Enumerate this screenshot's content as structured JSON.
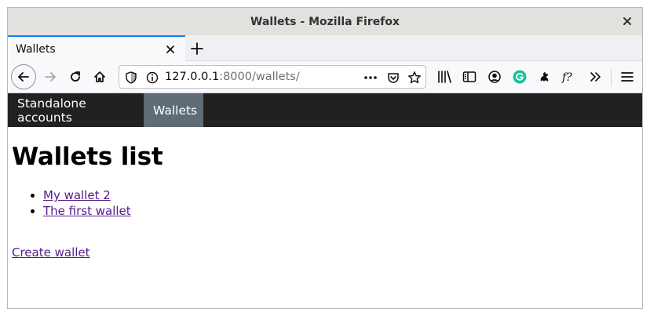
{
  "window": {
    "title": "Wallets - Mozilla Firefox"
  },
  "tabs": [
    {
      "label": "Wallets",
      "active": true
    }
  ],
  "toolbar": {
    "url_host": "127.0.0.1",
    "url_rest": ":8000/wallets/",
    "icons": [
      "back-icon",
      "forward-icon",
      "reload-icon",
      "home-icon",
      "shield-icon",
      "more-icon",
      "pocket-icon",
      "star-icon",
      "library-icon",
      "sidebar-icon",
      "account-icon",
      "grammarly-icon",
      "extension-icon",
      "function-icon",
      "overflow-icon",
      "menu-icon"
    ],
    "accent_color": "#0a84ff"
  },
  "site_nav": {
    "items": [
      {
        "label": "Standalone accounts",
        "active": false
      },
      {
        "label": "Wallets",
        "active": true
      }
    ],
    "background": "#212121",
    "active_background": "#5f6b75"
  },
  "main": {
    "heading": "Wallets list",
    "wallets": [
      {
        "label": "My wallet 2"
      },
      {
        "label": "The first wallet"
      }
    ],
    "create_label": "Create wallet",
    "link_color": "#551a8b"
  }
}
